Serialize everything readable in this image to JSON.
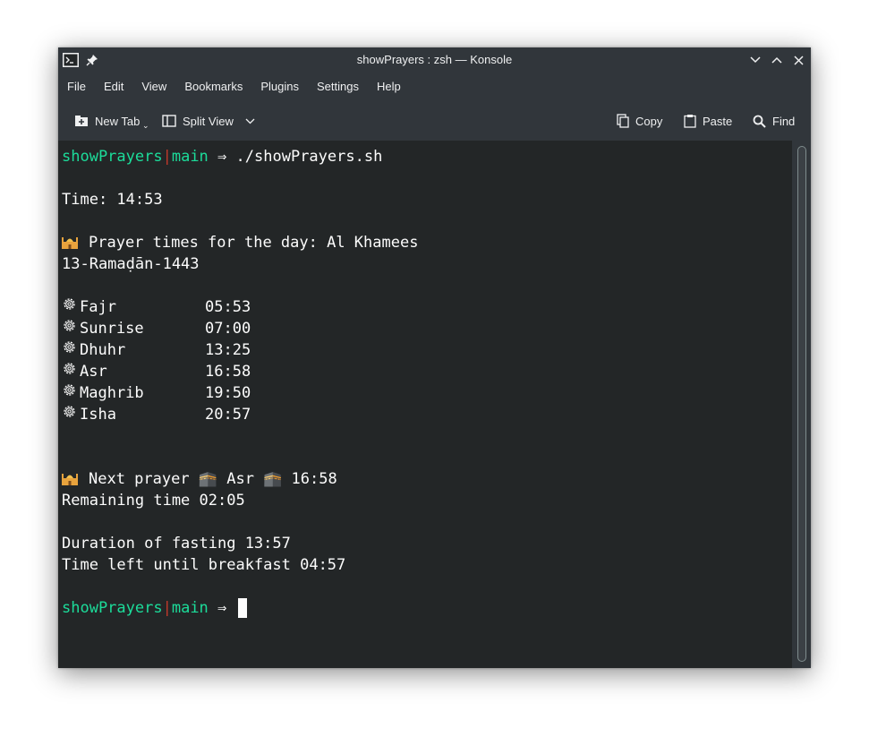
{
  "window": {
    "title": "showPrayers : zsh — Konsole"
  },
  "menu": [
    "File",
    "Edit",
    "View",
    "Bookmarks",
    "Plugins",
    "Settings",
    "Help"
  ],
  "toolbar": {
    "new_tab": "New Tab",
    "split_view": "Split View",
    "copy": "Copy",
    "paste": "Paste",
    "find": "Find"
  },
  "prompt": {
    "dir": "showPrayers",
    "separator": "|",
    "branch": "main",
    "arrow": "⇒",
    "command": "./showPrayers.sh"
  },
  "output": {
    "time": "Time: 14:53",
    "header": "Prayer times for the day: Al Khamees",
    "date": "13-Ramaḍān-1443",
    "prayers": [
      {
        "name": "Fajr",
        "time": "05:53"
      },
      {
        "name": "Sunrise",
        "time": "07:00"
      },
      {
        "name": "Dhuhr",
        "time": "13:25"
      },
      {
        "name": "Asr",
        "time": "16:58"
      },
      {
        "name": "Maghrib",
        "time": "19:50"
      },
      {
        "name": "Isha",
        "time": "20:57"
      }
    ],
    "next_prayer": "Next prayer 🕋 Asr 🕋 16:58",
    "remaining": "Remaining time 02:05",
    "fasting_duration": "Duration of fasting 13:57",
    "breakfast_left": "Time left until breakfast 04:57"
  },
  "icons": {
    "app": "terminal-icon",
    "pin": "pin-icon",
    "minimize": "chevron-down-icon",
    "maximize": "chevron-up-icon",
    "close": "close-icon",
    "new_tab": "new-tab-icon",
    "split_view": "split-view-icon",
    "copy": "copy-icon",
    "paste": "paste-icon",
    "find": "search-icon",
    "prayer_bullet": "gear-icon",
    "heading": "mosque-icon"
  },
  "colors": {
    "prompt_dir": "#1cdc9a",
    "prompt_sep": "#c0392b",
    "terminal_bg": "#232627",
    "chrome_bg": "#31363b",
    "text": "#fcfcfc"
  }
}
